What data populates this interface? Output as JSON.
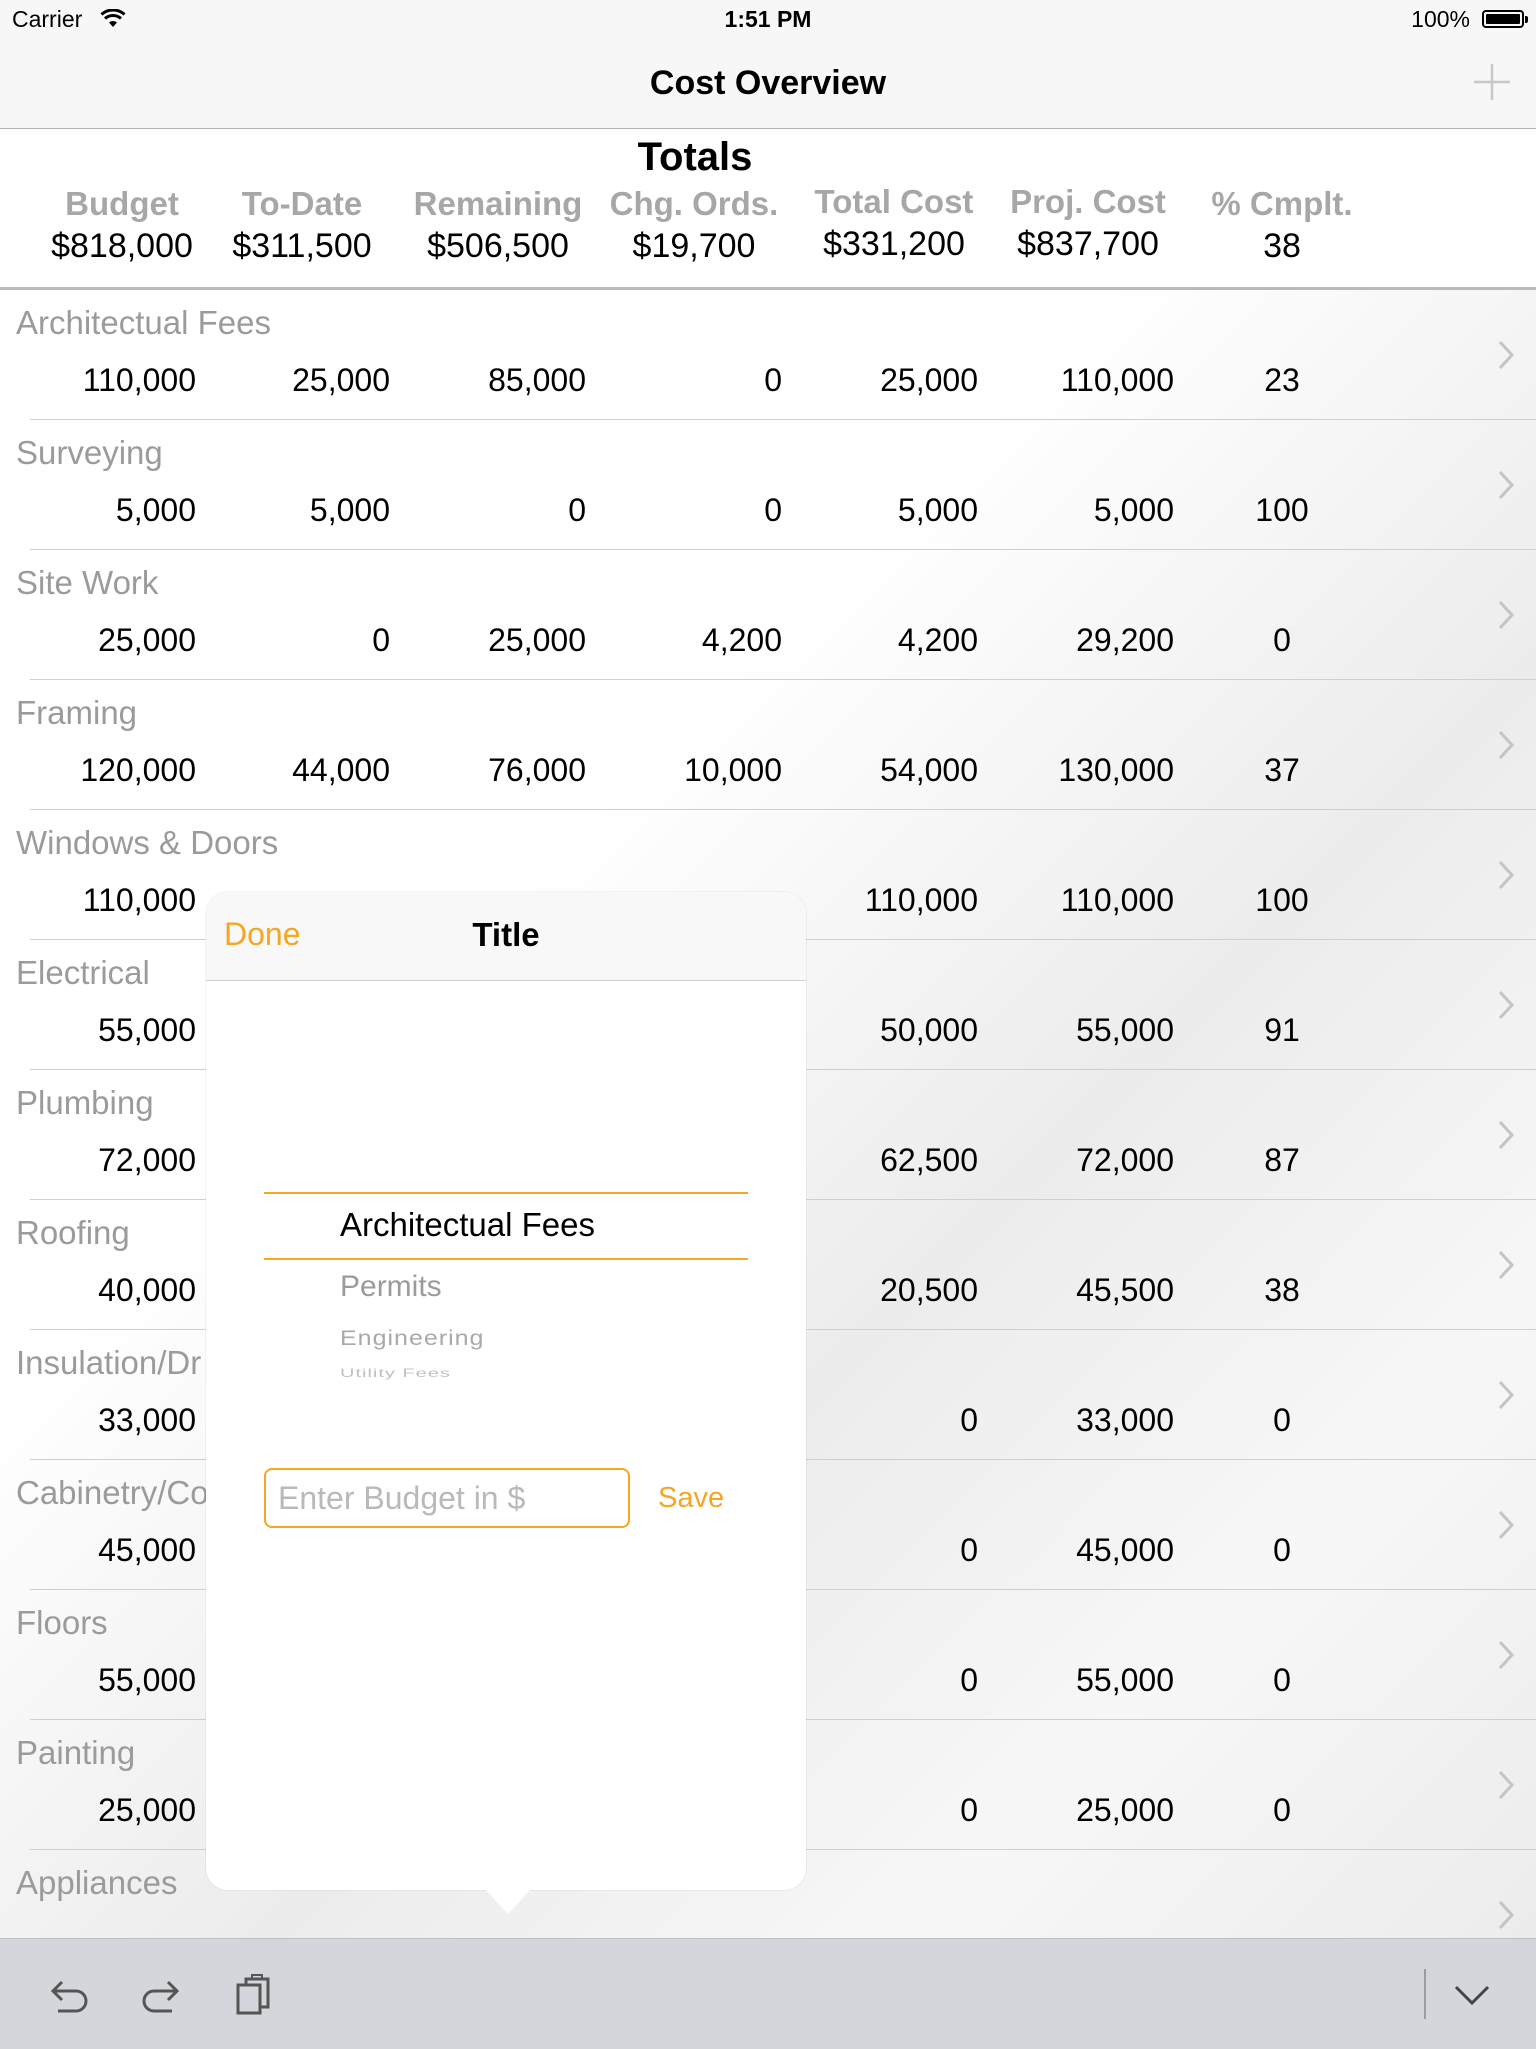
{
  "status_bar": {
    "carrier": "Carrier",
    "time": "1:51 PM",
    "battery": "100%"
  },
  "nav": {
    "title": "Cost Overview",
    "add_icon": "plus-icon"
  },
  "totals": {
    "title": "Totals",
    "columns": [
      {
        "label": "Budget",
        "value": "$818,000"
      },
      {
        "label": "To-Date",
        "value": "$311,500"
      },
      {
        "label": "Remaining",
        "value": "$506,500"
      },
      {
        "label": "Chg. Ords.",
        "value": "$19,700"
      },
      {
        "label": "Total Cost",
        "value": "$331,200"
      },
      {
        "label": "Proj. Cost",
        "value": "$837,700"
      },
      {
        "label": "% Cmplt.",
        "value": "38"
      }
    ]
  },
  "rows": [
    {
      "name": "Architectual  Fees",
      "values": [
        "110,000",
        "25,000",
        "85,000",
        "0",
        "25,000",
        "110,000",
        "23"
      ]
    },
    {
      "name": "Surveying",
      "values": [
        "5,000",
        "5,000",
        "0",
        "0",
        "5,000",
        "5,000",
        "100"
      ]
    },
    {
      "name": "Site Work",
      "values": [
        "25,000",
        "0",
        "25,000",
        "4,200",
        "4,200",
        "29,200",
        "0"
      ]
    },
    {
      "name": "Framing",
      "values": [
        "120,000",
        "44,000",
        "76,000",
        "10,000",
        "54,000",
        "130,000",
        "37"
      ]
    },
    {
      "name": "Windows & Doors",
      "values": [
        "110,000",
        "",
        "",
        "",
        "110,000",
        "110,000",
        "100"
      ]
    },
    {
      "name": "Electrical",
      "values": [
        "55,000",
        "",
        "",
        "",
        "50,000",
        "55,000",
        "91"
      ]
    },
    {
      "name": "Plumbing",
      "values": [
        "72,000",
        "",
        "",
        "",
        "62,500",
        "72,000",
        "87"
      ]
    },
    {
      "name": "Roofing",
      "values": [
        "40,000",
        "",
        "",
        "",
        "20,500",
        "45,500",
        "38"
      ]
    },
    {
      "name": "Insulation/Dr",
      "values": [
        "33,000",
        "",
        "",
        "",
        "0",
        "33,000",
        "0"
      ]
    },
    {
      "name": "Cabinetry/Co",
      "values": [
        "45,000",
        "",
        "",
        "",
        "0",
        "45,000",
        "0"
      ]
    },
    {
      "name": "Floors",
      "values": [
        "55,000",
        "",
        "",
        "",
        "0",
        "55,000",
        "0"
      ]
    },
    {
      "name": "Painting",
      "values": [
        "25,000",
        "",
        "",
        "",
        "0",
        "25,000",
        "0"
      ]
    },
    {
      "name": "Appliances",
      "values": [
        "",
        "",
        "",
        "",
        "",
        "",
        ""
      ]
    }
  ],
  "popover": {
    "done": "Done",
    "title": "Title",
    "picker_options": [
      "Architectual  Fees",
      "Permits",
      "Engineering",
      "Utility Fees"
    ],
    "selected": "Architectual  Fees",
    "budget_placeholder": "Enter Budget in $",
    "budget_value": "",
    "save": "Save"
  },
  "toolbar": {
    "icons": [
      "undo-icon",
      "redo-icon",
      "clipboard-icon",
      "chevron-down-icon"
    ]
  },
  "colors": {
    "accent": "#f5a623",
    "label_gray": "#9b9b9b",
    "toolbar_bg": "#d4d6dc"
  }
}
